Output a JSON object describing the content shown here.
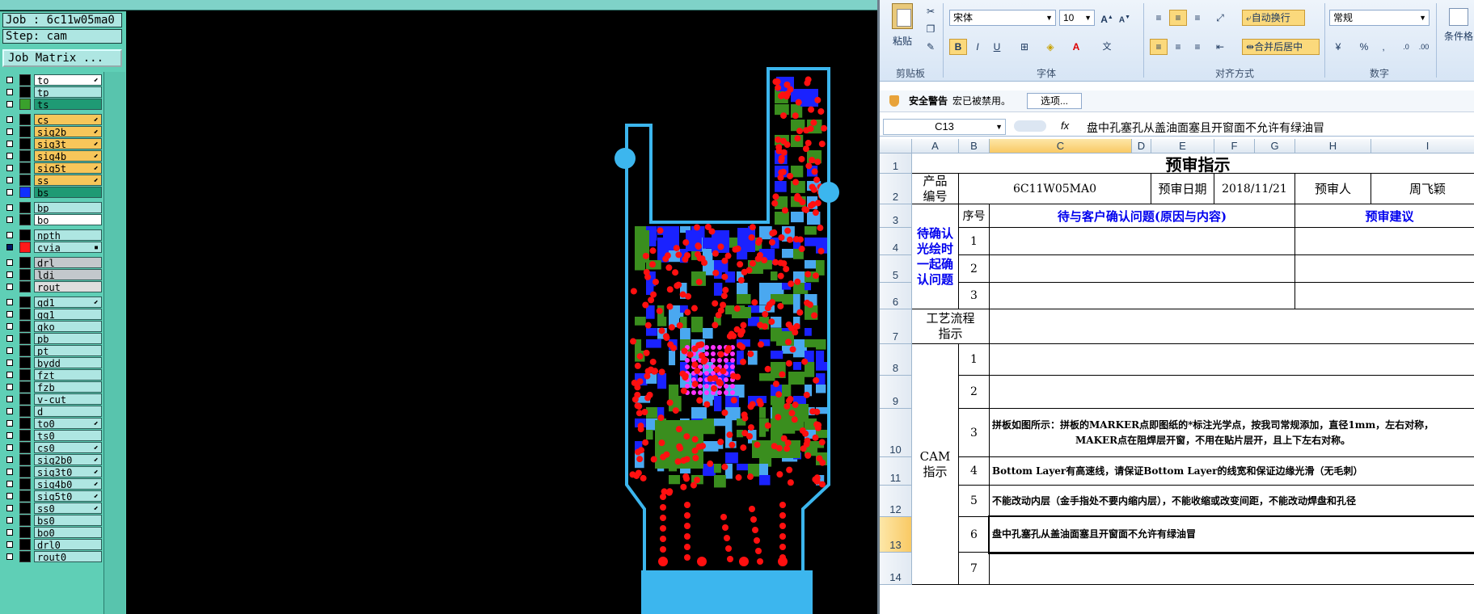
{
  "cam": {
    "job_label": "Job : 6c11w05ma0",
    "step_label": "Step: cam",
    "job_matrix_button": "Job Matrix ...",
    "layers": [
      {
        "name": "to",
        "swatch": "#000000",
        "bg": "#ffffff",
        "checked": false,
        "mark": "⬋"
      },
      {
        "name": "tp",
        "swatch": "#000000",
        "bg": "#aee6e2",
        "checked": false,
        "mark": ""
      },
      {
        "name": "ts",
        "swatch": "#3aa12c",
        "bg": "#1f9a74",
        "checked": false,
        "mark": ""
      },
      {
        "name": "cs",
        "swatch": "#000000",
        "bg": "#f7c65a",
        "checked": false,
        "mark": "⬋"
      },
      {
        "name": "sig2b",
        "swatch": "#000000",
        "bg": "#f7c65a",
        "checked": false,
        "mark": "⬋"
      },
      {
        "name": "sig3t",
        "swatch": "#000000",
        "bg": "#f7c65a",
        "checked": false,
        "mark": "⬋"
      },
      {
        "name": "sig4b",
        "swatch": "#000000",
        "bg": "#f7c65a",
        "checked": false,
        "mark": "⬋"
      },
      {
        "name": "sig5t",
        "swatch": "#000000",
        "bg": "#f7c65a",
        "checked": false,
        "mark": "⬋"
      },
      {
        "name": "ss",
        "swatch": "#000000",
        "bg": "#f7c65a",
        "checked": false,
        "mark": "⬋"
      },
      {
        "name": "bs",
        "swatch": "#1030ff",
        "bg": "#1f9a74",
        "checked": false,
        "mark": ""
      },
      {
        "name": "bp",
        "swatch": "#000000",
        "bg": "#aee6e2",
        "checked": false,
        "mark": ""
      },
      {
        "name": "bo",
        "swatch": "#000000",
        "bg": "#ffffff",
        "checked": false,
        "mark": ""
      },
      {
        "name": "npth",
        "swatch": "#000000",
        "bg": "#aee6e2",
        "checked": false,
        "mark": ""
      },
      {
        "name": "cvia",
        "swatch": "#ff1a1a",
        "bg": "#aee6e2",
        "checked": true,
        "mark": "▪"
      },
      {
        "name": "drl",
        "swatch": "#000000",
        "bg": "#c3c8cc",
        "checked": false,
        "mark": ""
      },
      {
        "name": "ldi",
        "swatch": "#000000",
        "bg": "#c3c8cc",
        "checked": false,
        "mark": ""
      },
      {
        "name": "rout",
        "swatch": "#000000",
        "bg": "#dedede",
        "checked": false,
        "mark": ""
      },
      {
        "name": "gd1",
        "swatch": "#000000",
        "bg": "#aee6e2",
        "checked": false,
        "mark": "⬋"
      },
      {
        "name": "gg1",
        "swatch": "#000000",
        "bg": "#aee6e2",
        "checked": false,
        "mark": ""
      },
      {
        "name": "gko",
        "swatch": "#000000",
        "bg": "#aee6e2",
        "checked": false,
        "mark": ""
      },
      {
        "name": "pb",
        "swatch": "#000000",
        "bg": "#aee6e2",
        "checked": false,
        "mark": ""
      },
      {
        "name": "pt",
        "swatch": "#000000",
        "bg": "#aee6e2",
        "checked": false,
        "mark": ""
      },
      {
        "name": "bydd",
        "swatch": "#000000",
        "bg": "#aee6e2",
        "checked": false,
        "mark": ""
      },
      {
        "name": "fzt",
        "swatch": "#000000",
        "bg": "#aee6e2",
        "checked": false,
        "mark": ""
      },
      {
        "name": "fzb",
        "swatch": "#000000",
        "bg": "#aee6e2",
        "checked": false,
        "mark": ""
      },
      {
        "name": "v-cut",
        "swatch": "#000000",
        "bg": "#aee6e2",
        "checked": false,
        "mark": ""
      },
      {
        "name": "d",
        "swatch": "#000000",
        "bg": "#aee6e2",
        "checked": false,
        "mark": ""
      },
      {
        "name": "to0",
        "swatch": "#000000",
        "bg": "#aee6e2",
        "checked": false,
        "mark": "⬋"
      },
      {
        "name": "ts0",
        "swatch": "#000000",
        "bg": "#aee6e2",
        "checked": false,
        "mark": ""
      },
      {
        "name": "cs0",
        "swatch": "#000000",
        "bg": "#aee6e2",
        "checked": false,
        "mark": "⬋"
      },
      {
        "name": "sig2b0",
        "swatch": "#000000",
        "bg": "#aee6e2",
        "checked": false,
        "mark": "⬋"
      },
      {
        "name": "sig3t0",
        "swatch": "#000000",
        "bg": "#aee6e2",
        "checked": false,
        "mark": "⬋"
      },
      {
        "name": "sig4b0",
        "swatch": "#000000",
        "bg": "#aee6e2",
        "checked": false,
        "mark": "⬋"
      },
      {
        "name": "sig5t0",
        "swatch": "#000000",
        "bg": "#aee6e2",
        "checked": false,
        "mark": "⬋"
      },
      {
        "name": "ss0",
        "swatch": "#000000",
        "bg": "#aee6e2",
        "checked": false,
        "mark": "⬋"
      },
      {
        "name": "bs0",
        "swatch": "#000000",
        "bg": "#aee6e2",
        "checked": false,
        "mark": ""
      },
      {
        "name": "bo0",
        "swatch": "#000000",
        "bg": "#aee6e2",
        "checked": false,
        "mark": ""
      },
      {
        "name": "drl0",
        "swatch": "#000000",
        "bg": "#aee6e2",
        "checked": false,
        "mark": ""
      },
      {
        "name": "rout0",
        "swatch": "#000000",
        "bg": "#aee6e2",
        "checked": false,
        "mark": ""
      }
    ],
    "colors": {
      "outline": "#3cb6ee",
      "pad_green": "#3a8e1e",
      "pad_blue": "#1a22ff",
      "pad_lightblue": "#4aa8f0",
      "via": "#ff1010",
      "bga": "#ff33ff",
      "background": "#000000"
    }
  },
  "excel": {
    "ribbon": {
      "paste_label": "粘贴",
      "clipboard_label": "剪贴板",
      "font_name": "宋体",
      "font_size": "10",
      "font_group_label": "字体",
      "wrap_text_label": "自动换行",
      "merge_center_label": "合并后居中",
      "align_group_label": "对齐方式",
      "number_format": "常规",
      "number_group_label": "数字",
      "conditional_format_label": "条件格",
      "bold": "B",
      "italic": "I",
      "underline": "U",
      "font_color": "A"
    },
    "security_bar": {
      "title": "安全警告",
      "message": "宏已被禁用。",
      "options_button": "选项..."
    },
    "formula_bar": {
      "name_box": "C13",
      "fx": "fx",
      "content": "盘中孔塞孔从盖油面塞且开窗面不允许有绿油冒"
    },
    "columns": [
      "A",
      "B",
      "C",
      "D",
      "E",
      "F",
      "G",
      "H",
      "I"
    ],
    "rows": [
      "1",
      "2",
      "3",
      "4",
      "5",
      "6",
      "7",
      "8",
      "9",
      "10",
      "11",
      "12",
      "13",
      "14"
    ],
    "sheet": {
      "title": "预审指示",
      "product_code_label": "产品\n编号",
      "product_code": "6C11W05MA0",
      "review_date_label": "预审日期",
      "review_date": "2018/11/21",
      "reviewer_label": "预审人",
      "reviewer": "周飞颖",
      "serial_label": "序号",
      "pending_label": "待确认\n光绘时\n一起确\n认问题",
      "issue_header": "待与客户确认问题(原因与内容)",
      "advice_header": "预审建议",
      "pending_numbers": [
        "1",
        "2",
        "3"
      ],
      "process_label": "工艺流程\n指示",
      "cam_label": "CAM\n指示",
      "cam_numbers": [
        "1",
        "2",
        "3",
        "4",
        "5",
        "6",
        "7"
      ],
      "cam_items": [
        "",
        "",
        "拼板如图所示：拼板的MARKER点即图纸的*标注光学点，按我司常规添加，直径1mm，左右对称，\nMAKER点在阻焊层开窗，不用在贴片层开，且上下左右对称。",
        " Bottom Layer有高速线，请保证Bottom Layer的线宽和保证边缘光滑（无毛刺）",
        "不能改动内层（金手指处不要内缩内层），不能收缩或改变间距，不能改动焊盘和孔径",
        "盘中孔塞孔从盖油面塞且开窗面不允许有绿油冒",
        ""
      ]
    },
    "colors": {
      "blue_text": "#0000ee",
      "selected_header": "#f9c964",
      "ribbon_bg": "#dbe7f5"
    }
  }
}
